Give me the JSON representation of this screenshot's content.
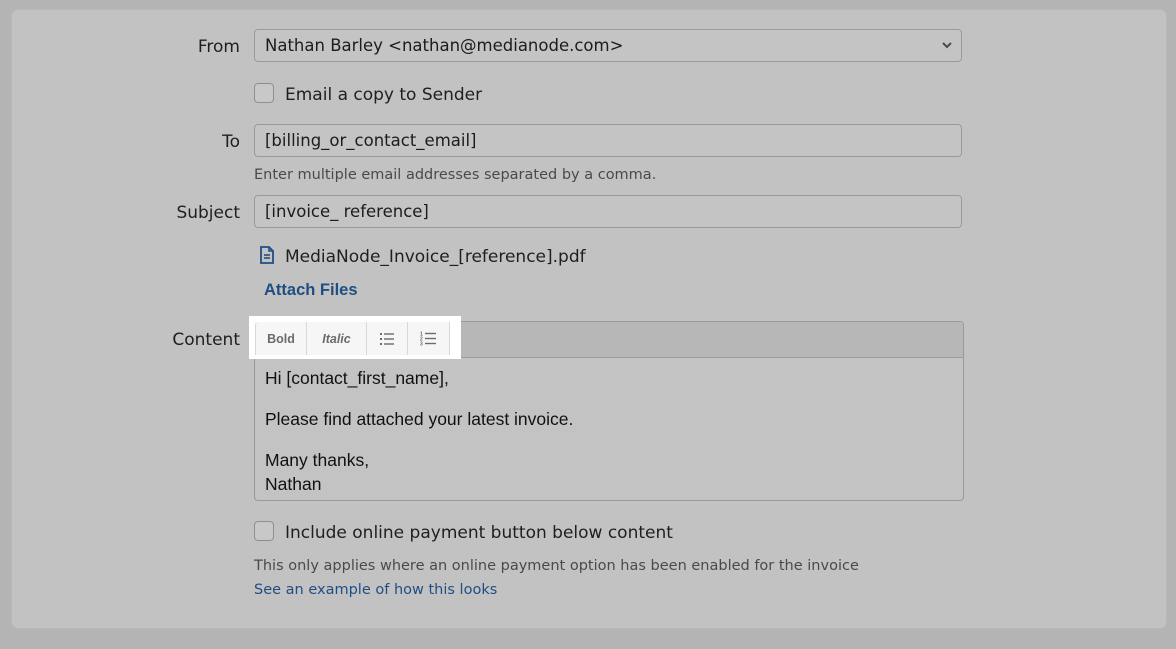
{
  "from": {
    "label": "From",
    "value": "Nathan Barley <nathan@medianode.com>"
  },
  "copy_sender": {
    "label": "Email a copy to Sender",
    "checked": false
  },
  "to": {
    "label": "To",
    "value": "[billing_or_contact_email]",
    "help": "Enter multiple email addresses separated by a comma."
  },
  "subject": {
    "label": "Subject",
    "value": "[invoice_ reference]"
  },
  "attachment": {
    "icon": "document-icon",
    "file_name": "MediaNode_Invoice_[reference].pdf",
    "attach_label": "Attach Files"
  },
  "content": {
    "label": "Content",
    "toolbar": {
      "bold": "Bold",
      "italic": "Italic",
      "bullet_icon": "bullet-list-icon",
      "number_icon": "numbered-list-icon"
    },
    "lines": {
      "greeting": "Hi [contact_first_name],",
      "body": "Please find attached your latest invoice.",
      "signoff": "Many thanks,",
      "name": "Nathan"
    }
  },
  "payment_button": {
    "label": "Include online payment button below content",
    "checked": false,
    "help": "This only applies where an online payment option has been enabled for the invoice",
    "example_link": "See an example of how this looks"
  },
  "colors": {
    "link": "#1e4e84",
    "toolbar_highlight": "#ffffff"
  }
}
